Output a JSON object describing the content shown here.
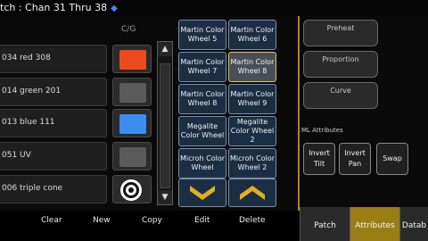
{
  "header": {
    "title": "tch :  Chan 31 Thru 38"
  },
  "column_header": "C/G",
  "rows": [
    {
      "label": "034 red 308",
      "color": "#ee4a1e"
    },
    {
      "label": "014 green 201",
      "color": "#5a5a5a"
    },
    {
      "label": "013 blue 111",
      "color": "#3d8cf0"
    },
    {
      "label": "051 UV",
      "color": "#5a5a5a"
    },
    {
      "label": "006 triple cone",
      "color": "target-icon"
    }
  ],
  "scroll": {
    "up": "▲",
    "down": "▼"
  },
  "grid_buttons": [
    {
      "label": "Martin Color Wheel 5",
      "selected": false
    },
    {
      "label": "Martin Color Wheel 6",
      "selected": false
    },
    {
      "label": "Martin Color Wheel 7",
      "selected": false
    },
    {
      "label": "Martin Color Wheel 8",
      "selected": true
    },
    {
      "label": "Martin Color Wheel 8",
      "selected": false
    },
    {
      "label": "Martin Color Wheel 9",
      "selected": false
    },
    {
      "label": "Megalite Color Wheel",
      "selected": false
    },
    {
      "label": "Megalite Color Wheel 2",
      "selected": false
    },
    {
      "label": "Microh Color Wheel",
      "selected": false
    },
    {
      "label": "Microh Color Wheel 2",
      "selected": false
    }
  ],
  "right_panel": {
    "buttons": [
      "Preheat",
      "Proportion",
      "Curve"
    ],
    "ml_title": "ML Attributes",
    "ml_buttons": [
      "Invert Tilt",
      "Invert Pan",
      "Swap"
    ]
  },
  "bottom_actions": [
    "Clear",
    "New",
    "Copy",
    "Edit",
    "Delete"
  ],
  "tabs": [
    {
      "label": "Patch",
      "active": false
    },
    {
      "label": "Attributes",
      "active": true
    },
    {
      "label": "Datab",
      "active": false
    }
  ],
  "colors": {
    "accent": "#a88818",
    "button_blue": "#1c2e44",
    "tab_active": "#9a7e14"
  }
}
